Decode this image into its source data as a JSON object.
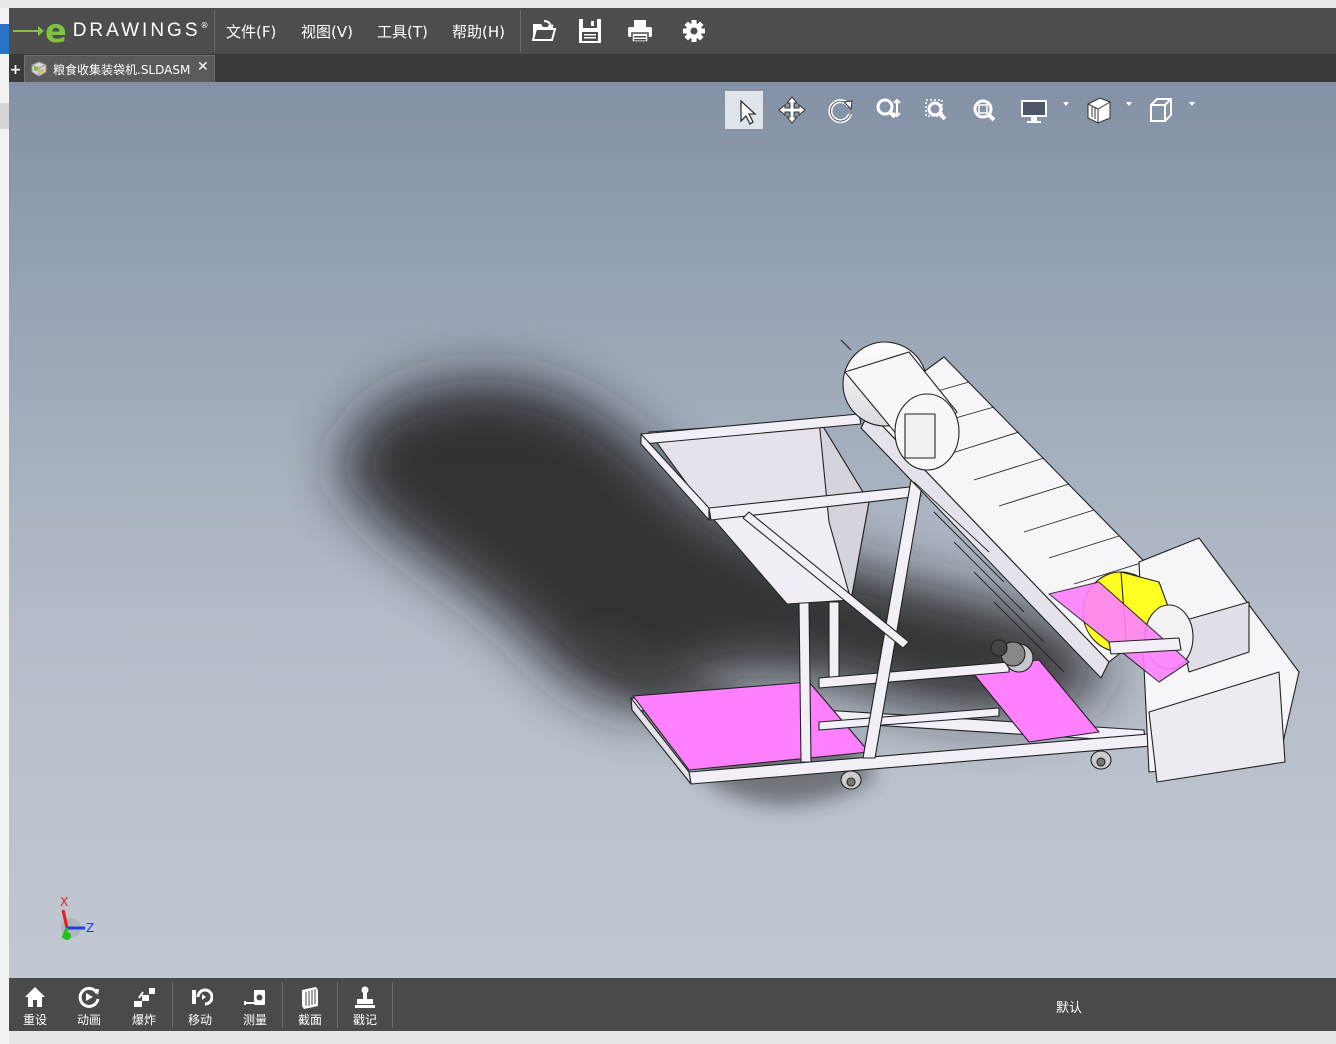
{
  "app": {
    "logo_text": "DRAWINGS",
    "logo_letter": "e",
    "accent_color": "#7fc241"
  },
  "menu": [
    {
      "label": "文件(F)"
    },
    {
      "label": "视图(V)"
    },
    {
      "label": "工具(T)"
    },
    {
      "label": "帮助(H)"
    }
  ],
  "menubar_icons": [
    "open-folder-icon",
    "save-icon",
    "print-icon",
    "settings-gear-icon"
  ],
  "tabs": {
    "new_tab": "+",
    "document": {
      "label": "粮食收集装袋机.SLDASM",
      "close": "✕"
    }
  },
  "view_toolbar": [
    "select-arrow-icon",
    "pan-icon",
    "rotate-icon",
    "zoom-icon",
    "zoom-to-area-icon",
    "zoom-to-fit-icon",
    "display-style-icon",
    "shading-icon",
    "standard-views-icon"
  ],
  "triad": {
    "x": "X",
    "z": "Z"
  },
  "bottom_toolbar": [
    {
      "label": "重设",
      "icon": "home-icon"
    },
    {
      "label": "动画",
      "icon": "animate-icon"
    },
    {
      "label": "爆炸",
      "icon": "explode-icon"
    },
    {
      "label": "移动",
      "icon": "move-icon"
    },
    {
      "label": "测量",
      "icon": "measure-icon"
    },
    {
      "label": "截面",
      "icon": "section-icon"
    },
    {
      "label": "戳记",
      "icon": "stamp-icon"
    }
  ],
  "status": {
    "configuration": "默认"
  },
  "colors": {
    "pink_panel": "#ff80ff",
    "yellow_drum": "#ffff22",
    "frame_white": "#f2f0f6"
  }
}
